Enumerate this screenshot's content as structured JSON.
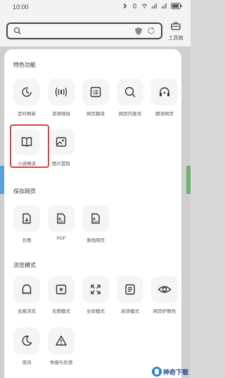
{
  "status_bar": {
    "time": "10:00"
  },
  "search": {
    "placeholder": ""
  },
  "toolbox": {
    "label": "工具箱"
  },
  "sections": [
    {
      "title": "特色功能",
      "items": [
        {
          "label": "定时刷新",
          "icon": "timer-icon"
        },
        {
          "label": "资源嗅探",
          "icon": "sniff-icon"
        },
        {
          "label": "网页翻译",
          "icon": "translate-icon"
        },
        {
          "label": "网页内查找",
          "icon": "find-in-page-icon"
        },
        {
          "label": "朗读网页",
          "icon": "read-aloud-icon"
        },
        {
          "label": "小说畅读",
          "icon": "book-icon"
        },
        {
          "label": "图片提取",
          "icon": "image-extract-icon"
        }
      ]
    },
    {
      "title": "保存网页",
      "items": [
        {
          "label": "长图",
          "icon": "long-image-icon"
        },
        {
          "label": "PDF",
          "icon": "pdf-icon"
        },
        {
          "label": "离线网页",
          "icon": "html-icon"
        }
      ]
    },
    {
      "title": "浏览模式",
      "items": [
        {
          "label": "无痕浏览",
          "icon": "ghost-icon"
        },
        {
          "label": "无图模式",
          "icon": "no-image-icon"
        },
        {
          "label": "全屏模式",
          "icon": "fullscreen-icon"
        },
        {
          "label": "阅读模式",
          "icon": "reader-icon"
        },
        {
          "label": "网页护眼色",
          "icon": "eye-icon"
        },
        {
          "label": "夜间",
          "icon": "moon-icon"
        },
        {
          "label": "举报与反馈",
          "icon": "report-icon"
        }
      ]
    }
  ],
  "watermark": {
    "text": "神奇下载"
  },
  "colors": {
    "highlight": "#e0413a",
    "panel": "#ffffff",
    "icon_bg": "#f5f5f5"
  }
}
